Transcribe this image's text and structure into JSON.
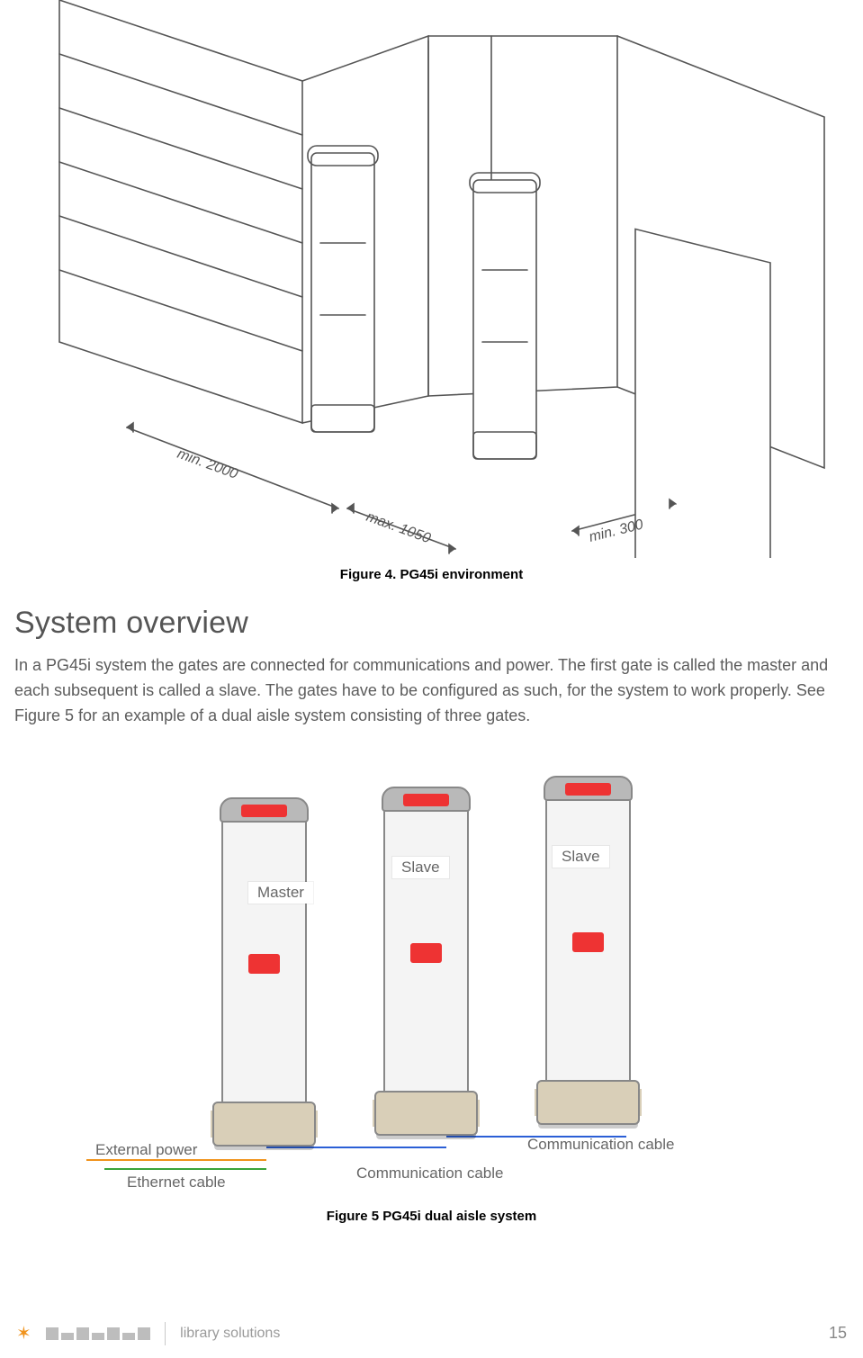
{
  "figure4": {
    "caption": "Figure 4. PG45i environment",
    "labels": {
      "min2000": "min. 2000",
      "max1050": "max. 1050",
      "min300": "min. 300"
    }
  },
  "heading": "System overview",
  "paragraph": "In a PG45i system the gates are connected for communications and power. The first gate is called the master and each subsequent is called a slave. The gates have to be configured as such, for the system to work properly. See Figure 5 for an example of a dual aisle system consisting of three gates.",
  "figure5": {
    "caption": "Figure 5 PG45i dual aisle system",
    "gateLabels": {
      "master": "Master",
      "slave1": "Slave",
      "slave2": "Slave"
    },
    "cables": {
      "externalPower": "External power",
      "ethernet": "Ethernet cable",
      "comm1": "Communication cable",
      "comm2": "Communication cable"
    }
  },
  "footer": {
    "brand": "nedap",
    "sub": "library solutions",
    "page": "15"
  }
}
